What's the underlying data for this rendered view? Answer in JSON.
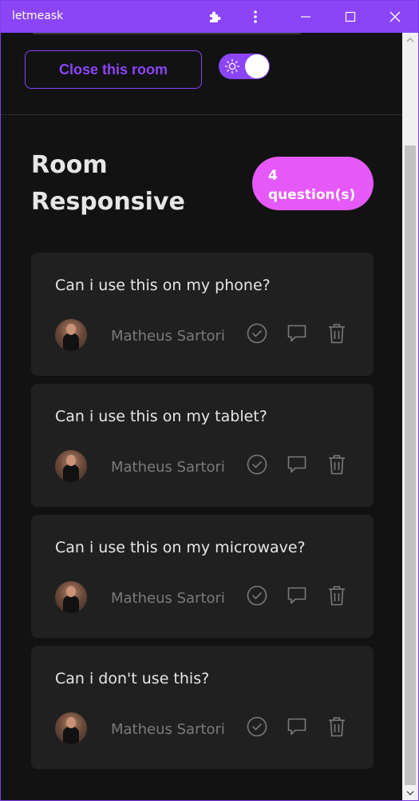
{
  "window": {
    "title": "letmeask"
  },
  "header": {
    "close_room_label": "Close this room",
    "theme_toggle": "on"
  },
  "room": {
    "title": "Room Responsive",
    "question_count_line1": "4",
    "question_count_line2": "question(s)"
  },
  "questions": [
    {
      "content": "Can i use this on my phone?",
      "author": "Matheus Sartori"
    },
    {
      "content": "Can i use this on my tablet?",
      "author": "Matheus Sartori"
    },
    {
      "content": "Can i use this on my microwave?",
      "author": "Matheus Sartori"
    },
    {
      "content": "Can i don't use this?",
      "author": "Matheus Sartori"
    }
  ],
  "colors": {
    "accent": "#8b45f7",
    "badge": "#e559f9",
    "background": "#121212",
    "card": "#202020"
  },
  "icons": {
    "titlebar": [
      "puzzle-icon",
      "more-vertical-icon",
      "minimize-icon",
      "maximize-icon",
      "close-icon"
    ],
    "question_actions": [
      "check-circle-icon",
      "message-icon",
      "trash-icon"
    ],
    "toggle": "sun-icon"
  }
}
